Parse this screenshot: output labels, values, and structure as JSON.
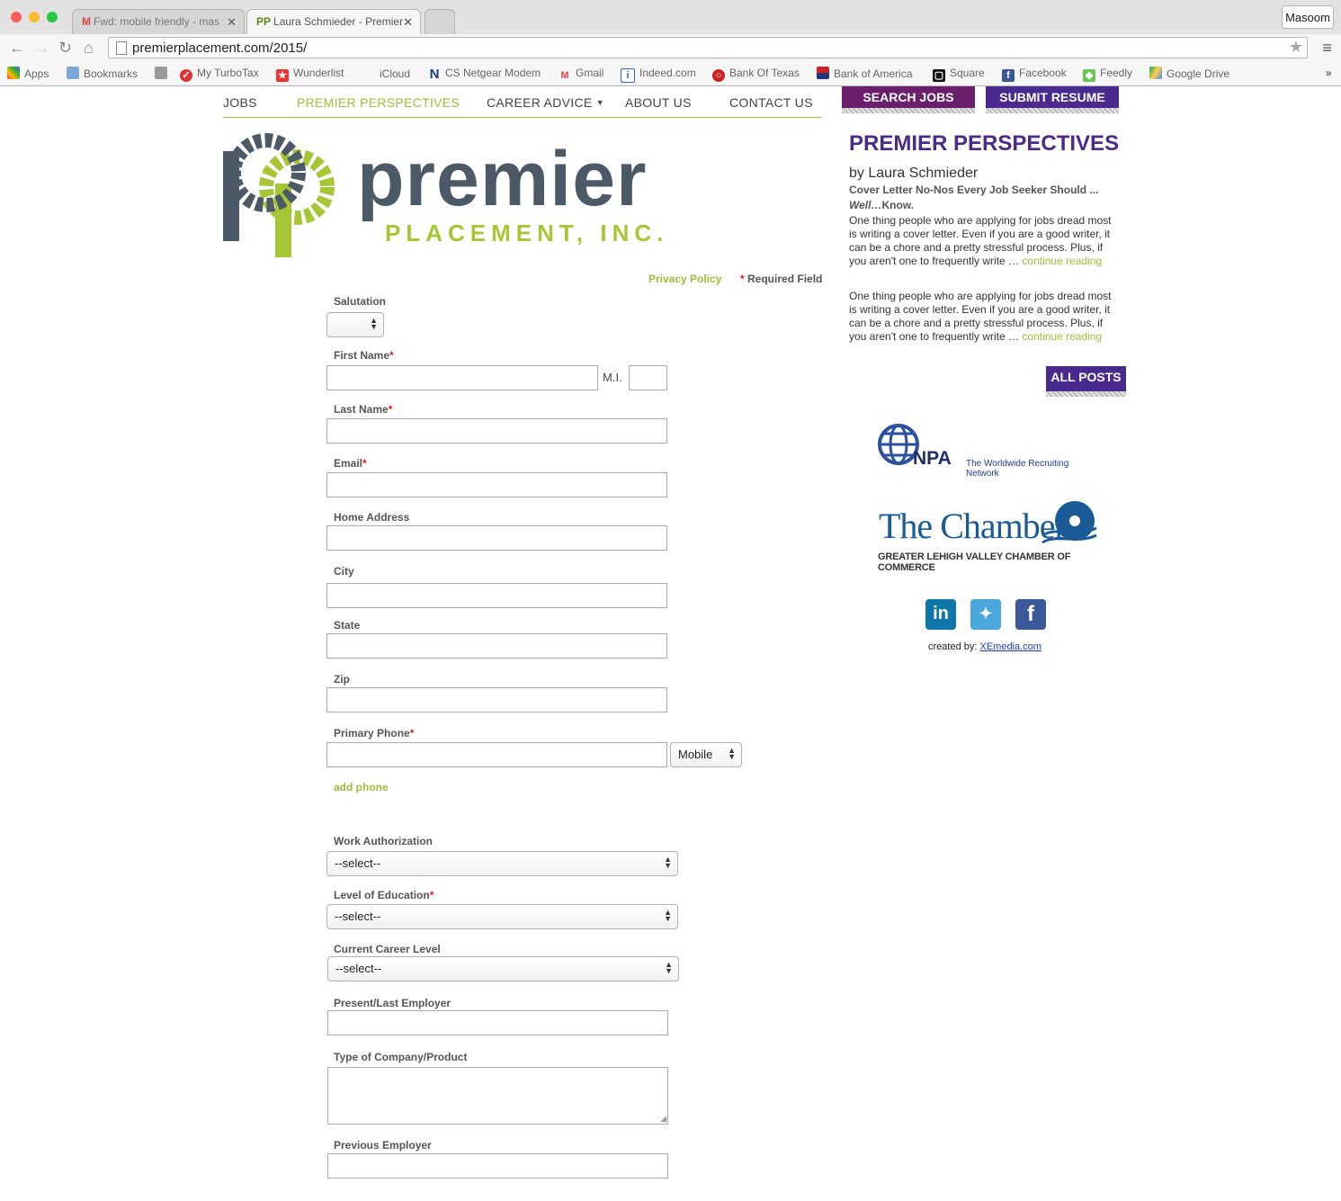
{
  "browser": {
    "tabs": [
      {
        "label": "Fwd: mobile friendly - mas"
      },
      {
        "label": "Laura Schmieder - Premier"
      }
    ],
    "profile": "Masoom",
    "url": "premierplacement.com/2015/",
    "bookmarks": [
      "Apps",
      "Bookmarks",
      "My TurboTax",
      "Wunderlist",
      "iCloud",
      "CS Netgear Modem",
      "Gmail",
      "Indeed.com",
      "Bank Of Texas",
      "Bank of America",
      "Square",
      "Facebook",
      "Feedly",
      "Google Drive"
    ],
    "overflow": "»"
  },
  "nav": {
    "jobs": "JOBS",
    "perspectives": "PREMIER PERSPECTIVES",
    "career": "CAREER ADVICE",
    "about": "ABOUT US",
    "contact": "CONTACT US",
    "search_jobs": "SEARCH JOBS",
    "submit_resume": "SUBMIT RESUME"
  },
  "logo": {
    "word": "premier",
    "sub": "PLACEMENT, INC."
  },
  "form": {
    "privacy": "Privacy Policy",
    "required_star": "*",
    "required_text": "Required Field",
    "salutation": "Salutation",
    "first_name": "First Name",
    "mi": "M.I.",
    "last_name": "Last Name",
    "email": "Email",
    "home_address": "Home Address",
    "city": "City",
    "state": "State",
    "zip": "Zip",
    "primary_phone": "Primary Phone",
    "phone_type": "Mobile",
    "add_phone": "add phone",
    "work_auth": "Work Authorization",
    "education": "Level of Education",
    "career_level": "Current Career Level",
    "select_placeholder": "--select--",
    "employer": "Present/Last Employer",
    "company_type": "Type of Company/Product",
    "previous_employer": "Previous Employer"
  },
  "aside": {
    "title": "PREMIER PERSPECTIVES",
    "author": "by Laura Schmieder",
    "post_title": "Cover Letter No-Nos Every Job Seeker Should ...",
    "post_title_2a": "Well…",
    "post_title_2b": "Know.",
    "excerpt": "One thing people who are applying for jobs dread most is writing a cover letter. Even if you are a good writer, it can be a chore and a pretty stressful process. Plus, if you aren't one to frequently write … ",
    "continue": "continue reading",
    "all_posts": "ALL POSTS",
    "npa_name": "NPA",
    "npa_tag": "The Worldwide Recruiting Network",
    "chamber_name": "The Chamber",
    "chamber_sub": "GREATER LEHIGH VALLEY CHAMBER OF COMMERCE",
    "created_by": "created by: ",
    "credit_link": "XEmedia.com"
  }
}
